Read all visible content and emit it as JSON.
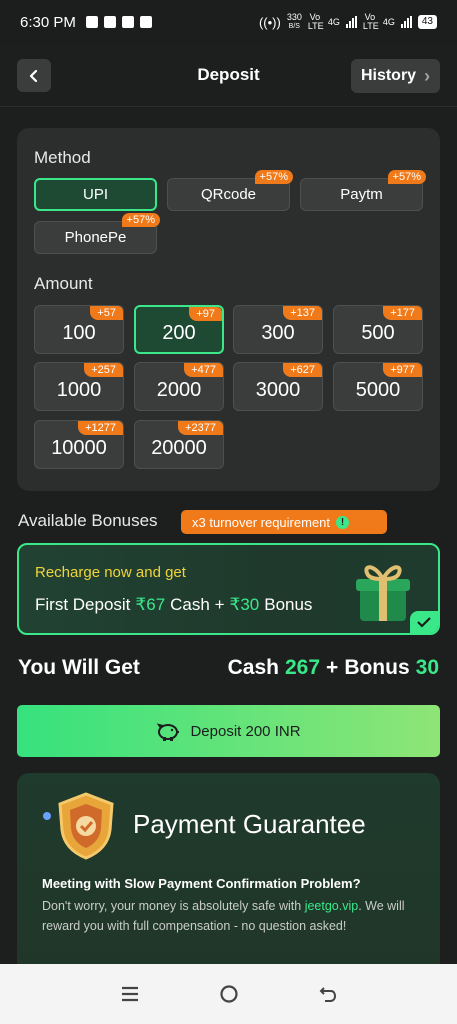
{
  "status_bar": {
    "time": "6:30 PM",
    "net_speed_top": "330",
    "net_speed_unit": "B/S",
    "sim1": "Vo LTE",
    "sim1_net": "4G",
    "sim2": "Vo LTE",
    "sim2_net": "4G",
    "battery": "43"
  },
  "header": {
    "title": "Deposit",
    "history_label": "History",
    "back_icon": "chevron-left-icon"
  },
  "method": {
    "label": "Method",
    "options": [
      {
        "label": "UPI",
        "badge": "",
        "selected": true
      },
      {
        "label": "QRcode",
        "badge": "+57%",
        "selected": false
      },
      {
        "label": "Paytm",
        "badge": "+57%",
        "selected": false
      },
      {
        "label": "PhonePe",
        "badge": "+57%",
        "selected": false
      }
    ]
  },
  "amount": {
    "label": "Amount",
    "options": [
      {
        "value": "100",
        "badge": "+57"
      },
      {
        "value": "200",
        "badge": "+97",
        "selected": true
      },
      {
        "value": "300",
        "badge": "+137"
      },
      {
        "value": "500",
        "badge": "+177"
      },
      {
        "value": "1000",
        "badge": "+257"
      },
      {
        "value": "2000",
        "badge": "+477"
      },
      {
        "value": "3000",
        "badge": "+627"
      },
      {
        "value": "5000",
        "badge": "+977"
      },
      {
        "value": "10000",
        "badge": "+1277"
      },
      {
        "value": "20000",
        "badge": "+2377"
      }
    ]
  },
  "bonuses": {
    "title": "Available Bonuses",
    "turnover": "x3 turnover requirement",
    "line1": "Recharge now and get",
    "line2_prefix": "First Deposit",
    "cash_amount": "₹67",
    "cash_label": "Cash +",
    "bonus_amount": "₹30",
    "bonus_label": "Bonus"
  },
  "you_will_get": {
    "title": "You Will Get",
    "cash_label": "Cash",
    "cash_value": "267",
    "plus": "+",
    "bonus_label": "Bonus",
    "bonus_value": "30"
  },
  "deposit_button": {
    "label": "Deposit 200 INR"
  },
  "guarantee": {
    "title": "Payment Guarantee",
    "headline": "Meeting with Slow Payment Confirmation Problem?",
    "body_prefix": "Don't worry, your money is absolutely safe with ",
    "link": "jeetgo.vip",
    "body_suffix": ". We will reward you with full compensation - no question asked!"
  },
  "colors": {
    "accent": "#3ae88a",
    "badge": "#f07a1a",
    "background": "#1c1f1e"
  }
}
